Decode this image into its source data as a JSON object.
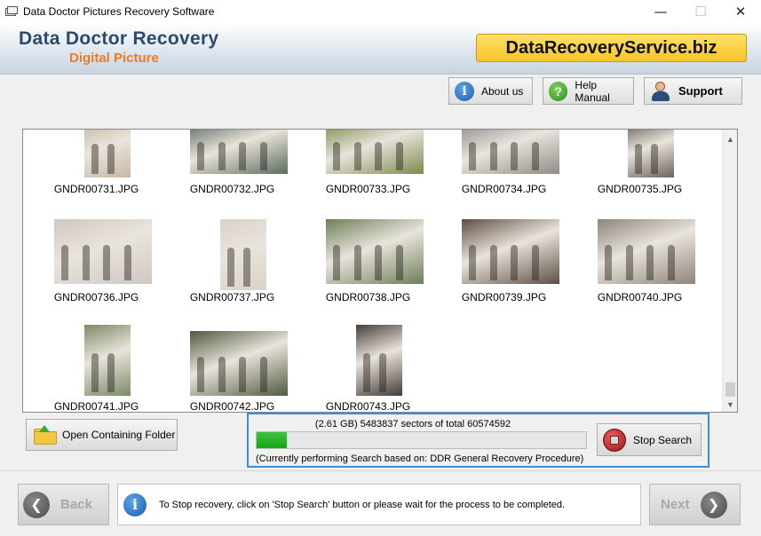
{
  "window": {
    "title": "Data Doctor Pictures Recovery Software",
    "min_glyph": "—",
    "max_glyph": "☐",
    "close_glyph": "✕"
  },
  "banner": {
    "title": "Data Doctor Recovery",
    "subtitle": "Digital Picture",
    "url": "DataRecoveryService.biz"
  },
  "toolbar": {
    "about_label": "About us",
    "help_label": "Help Manual",
    "support_label": "Support"
  },
  "gallery": {
    "files": [
      {
        "name": "GNDR00731.JPG",
        "tone": "#c9b7a2"
      },
      {
        "name": "GNDR00732.JPG",
        "tone": "#5c6b5e"
      },
      {
        "name": "GNDR00733.JPG",
        "tone": "#7d8a4e"
      },
      {
        "name": "GNDR00734.JPG",
        "tone": "#8f8b86"
      },
      {
        "name": "GNDR00735.JPG",
        "tone": "#6c625a"
      },
      {
        "name": "GNDR00736.JPG",
        "tone": "#cfc8c0"
      },
      {
        "name": "GNDR00737.JPG",
        "tone": "#d9d2c8"
      },
      {
        "name": "GNDR00738.JPG",
        "tone": "#6d7f57"
      },
      {
        "name": "GNDR00739.JPG",
        "tone": "#5d4e44"
      },
      {
        "name": "GNDR00740.JPG",
        "tone": "#8e857b"
      },
      {
        "name": "GNDR00741.JPG",
        "tone": "#7c8a66"
      },
      {
        "name": "GNDR00742.JPG",
        "tone": "#4f5a3e"
      },
      {
        "name": "GNDR00743.JPG",
        "tone": "#453d38"
      }
    ]
  },
  "actions": {
    "open_folder_label": "Open Containing Folder"
  },
  "progress": {
    "status": "(2.61 GB) 5483837  sectors  of  total 60574592",
    "sectors_done": 5483837,
    "sectors_total": 60574592,
    "procedure": "(Currently performing Search based on:  DDR General Recovery Procedure)",
    "stop_label": "Stop Search"
  },
  "footer": {
    "back_label": "Back",
    "next_label": "Next",
    "hint": "To Stop recovery, click on 'Stop Search' button or please wait for the process to be completed."
  },
  "colors": {
    "accent": "#3d8fd6",
    "progress_fill": "#11a911",
    "brand_orange": "#ee7a22",
    "brand_blue": "#2f4a6b"
  }
}
